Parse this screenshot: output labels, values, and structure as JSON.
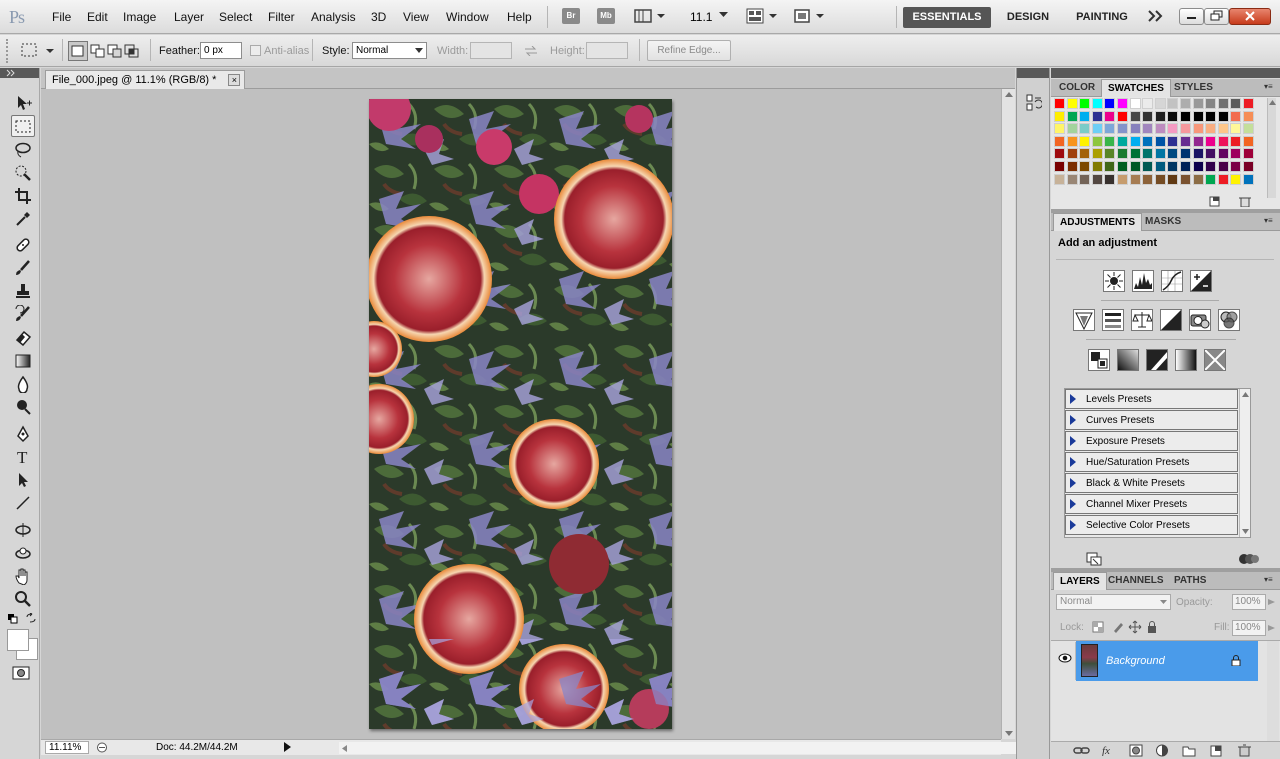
{
  "app": {
    "logo": "Ps"
  },
  "menu": [
    "File",
    "Edit",
    "Image",
    "Layer",
    "Select",
    "Filter",
    "Analysis",
    "3D",
    "View",
    "Window",
    "Help"
  ],
  "appbar": {
    "br": "Br",
    "mb": "Mb",
    "zoom": "11.1",
    "workspaces": [
      "ESSENTIALS",
      "DESIGN",
      "PAINTING"
    ]
  },
  "options": {
    "feather_label": "Feather:",
    "feather_value": "0 px",
    "antialias_label": "Anti-alias",
    "style_label": "Style:",
    "style_value": "Normal",
    "width_label": "Width:",
    "height_label": "Height:",
    "refine_label": "Refine Edge..."
  },
  "document": {
    "tab_title": "File_000.jpeg @ 11.1% (RGB/8) *",
    "close": "×"
  },
  "status": {
    "zoom": "11.11%",
    "doc": "Doc: 44.2M/44.2M"
  },
  "swatches_panel": {
    "tabs": [
      "COLOR",
      "SWATCHES",
      "STYLES"
    ],
    "rows": [
      [
        "#ff0000",
        "#ffff00",
        "#00ff00",
        "#00ffff",
        "#0000ff",
        "#ff00ff",
        "#ffffff",
        "#ebebeb",
        "#d6d6d6",
        "#c2c2c2",
        "#adadad",
        "#999999",
        "#858585",
        "#707070",
        "#5c5c5c",
        "#ed1c24"
      ],
      [
        "#ffed00",
        "#00a651",
        "#00aeef",
        "#2e3192",
        "#ec008c",
        "#fe0000",
        "#474747",
        "#333333",
        "#1f1f1f",
        "#0a0a0a",
        "#000000",
        "#000000",
        "#000000",
        "#000000",
        "#f26c4f",
        "#f68e56"
      ],
      [
        "#fff568",
        "#a3d39c",
        "#7accc8",
        "#6dcff6",
        "#7da7d9",
        "#8393ca",
        "#8781bd",
        "#a186be",
        "#bd8cbf",
        "#f49ac2",
        "#f5989d",
        "#f7977a",
        "#f9ad81",
        "#fdc689",
        "#fff799",
        "#c4df9b"
      ],
      [
        "#f26522",
        "#f7941d",
        "#fff200",
        "#8dc63f",
        "#39b54a",
        "#00a99d",
        "#00aeef",
        "#0072bc",
        "#0054a6",
        "#2e3192",
        "#662d91",
        "#92278f",
        "#ec008c",
        "#ed145b",
        "#ed1c24",
        "#f26522"
      ],
      [
        "#9e0b0f",
        "#a0410d",
        "#a36209",
        "#aba000",
        "#598527",
        "#1a7b30",
        "#007236",
        "#00746b",
        "#0076a3",
        "#004a80",
        "#003471",
        "#1b1464",
        "#440e62",
        "#630460",
        "#9e005d",
        "#9e0039"
      ],
      [
        "#790000",
        "#7b2e00",
        "#7d4900",
        "#827b00",
        "#406618",
        "#005e20",
        "#005826",
        "#005952",
        "#005b7f",
        "#003663",
        "#002157",
        "#0d004c",
        "#32004b",
        "#4b0049",
        "#7b0046",
        "#7a0026"
      ],
      [
        "#c7b299",
        "#998675",
        "#736357",
        "#534741",
        "#37302d",
        "#c69c6d",
        "#a67c52",
        "#8c6239",
        "#754c24",
        "#603913",
        "#7a5230",
        "#8c6d46",
        "#00a651",
        "#ed1c24",
        "#fff200",
        "#0072bc"
      ]
    ]
  },
  "adjustments_panel": {
    "tabs": [
      "ADJUSTMENTS",
      "MASKS"
    ],
    "heading": "Add an adjustment",
    "presets": [
      "Levels Presets",
      "Curves Presets",
      "Exposure Presets",
      "Hue/Saturation Presets",
      "Black & White Presets",
      "Channel Mixer Presets",
      "Selective Color Presets"
    ]
  },
  "layers_panel": {
    "tabs": [
      "LAYERS",
      "CHANNELS",
      "PATHS"
    ],
    "blend_mode": "Normal",
    "opacity_label": "Opacity:",
    "opacity_value": "100%",
    "lock_label": "Lock:",
    "fill_label": "Fill:",
    "fill_value": "100%",
    "layer_name": "Background"
  }
}
